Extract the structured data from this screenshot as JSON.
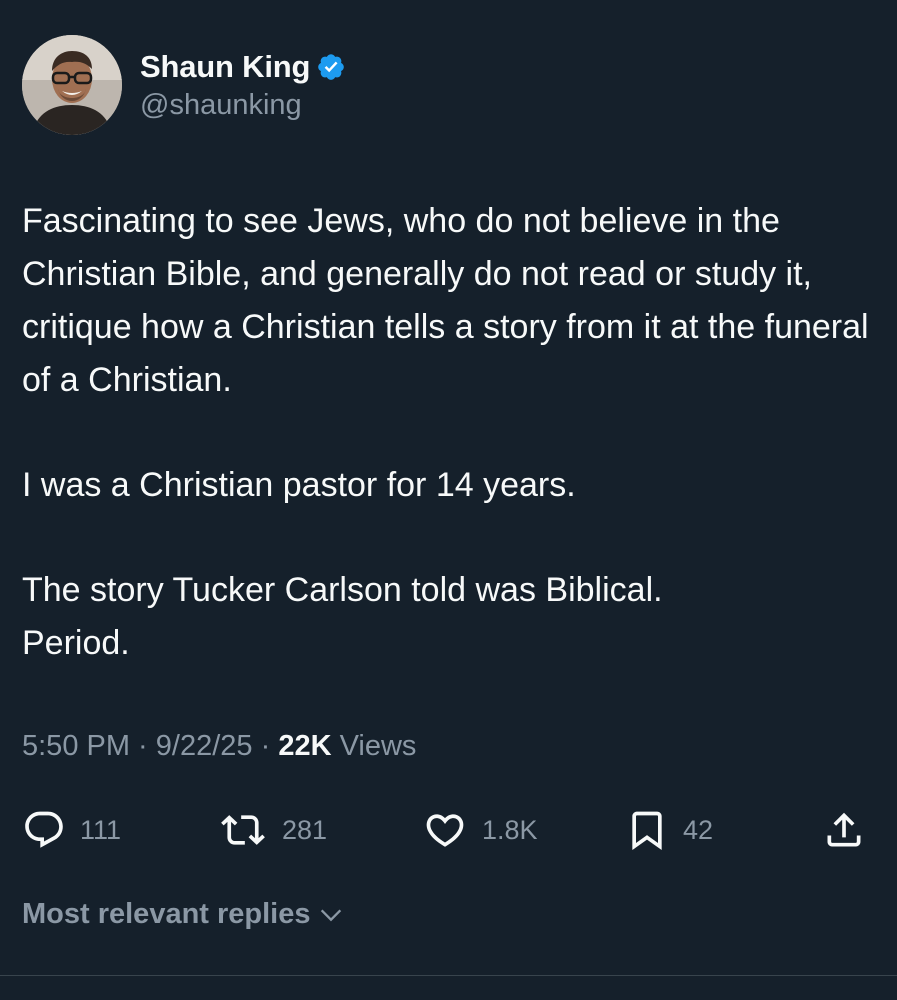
{
  "author": {
    "display_name": "Shaun King",
    "handle": "@shaunking",
    "verified_icon": "verified-badge-icon",
    "verified_color": "#1d9bf0"
  },
  "tweet": {
    "paragraphs": [
      "Fascinating to see Jews, who do not believe in the Christian Bible, and generally do not read or study it, critique how a Christian tells a story from it at the funeral of a Christian.",
      "I was a Christian pastor for 14 years.",
      "The story Tucker Carlson told was Biblical.\nPeriod."
    ]
  },
  "meta": {
    "time": "5:50 PM",
    "separator": " · ",
    "date": "9/22/25",
    "views_count": "22K",
    "views_label": " Views"
  },
  "actions": {
    "reply": {
      "icon": "reply-icon",
      "count": "111"
    },
    "repost": {
      "icon": "repost-icon",
      "count": "281"
    },
    "like": {
      "icon": "heart-icon",
      "count": "1.8K"
    },
    "bookmark": {
      "icon": "bookmark-icon",
      "count": "42"
    },
    "share": {
      "icon": "share-icon"
    }
  },
  "replies": {
    "sort_label": "Most relevant replies",
    "icon": "chevron-down-icon"
  },
  "colors": {
    "background": "#15202b",
    "primary_text": "#f7f9f9",
    "secondary_text": "#8b98a5",
    "divider": "#38444d"
  }
}
